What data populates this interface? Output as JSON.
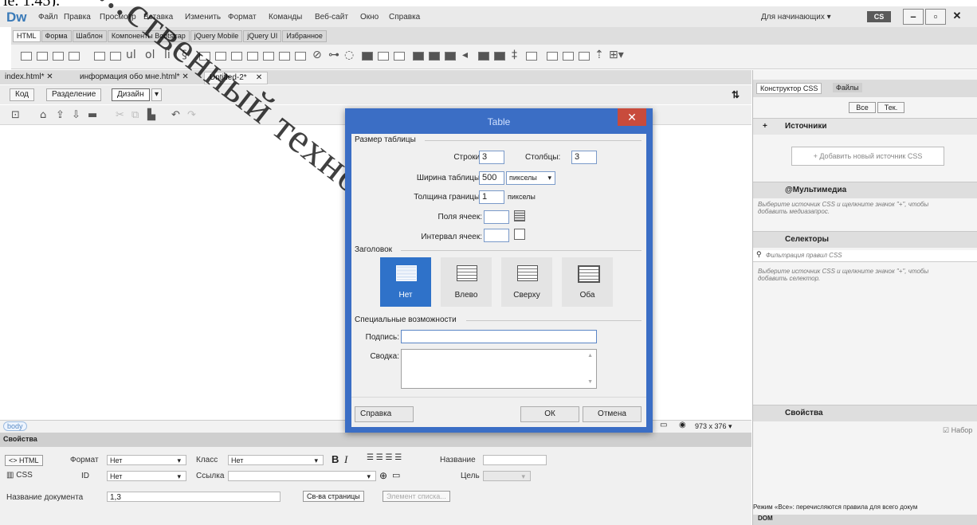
{
  "top_cut_text": "ie. 1.45).",
  "app": {
    "logo": "Dw",
    "menu": [
      "Файл",
      "Правка",
      "Просмотр",
      "Вставка",
      "Изменить",
      "Формат",
      "Команды",
      "Веб-сайт",
      "Окно",
      "Справка"
    ],
    "workspace": "Для начинающих",
    "sync_label": "CS"
  },
  "insert_tabs": [
    "HTML",
    "Форма",
    "Шаблон",
    "Компоненты Bootstrap",
    "jQuery Mobile",
    "jQuery UI",
    "Избранное"
  ],
  "doc_tabs": [
    "index.html*",
    "информация обо мне.html*",
    "Untitled-2*"
  ],
  "view_buttons": [
    "Код",
    "Разделение",
    "Дизайн"
  ],
  "status": {
    "tag": "body",
    "size": "973 x 376"
  },
  "properties": {
    "title": "Свойства",
    "html_btn": "<> HTML",
    "css_btn": "CSS",
    "format_label": "Формат",
    "format_value": "Нет",
    "class_label": "Класс",
    "class_value": "Нет",
    "id_label": "ID",
    "id_value": "Нет",
    "link_label": "Ссылка",
    "title_label": "Название",
    "target_label": "Цель",
    "doc_title_label": "Название документа",
    "doc_title_value": "1,3",
    "page_props": "Св-ва страницы",
    "list_item": "Элемент списка..."
  },
  "right_panel": {
    "tab_css": "Конструктор CSS",
    "tab_files": "Файлы",
    "all": "Все",
    "current": "Тек.",
    "sources_head": "Источники",
    "add_source": "+ Добавить новый источник CSS",
    "media_head": "@Мультимедиа",
    "media_hint": "Выберите источник CSS и щелкните значок \"+\", чтобы добавить медиазапрос.",
    "selectors_head": "Селекторы",
    "filter_placeholder": "Фильтрация правил CSS",
    "selectors_hint": "Выберите источник CSS и щелкните значок \"+\", чтобы добавить селектор.",
    "props_head": "Свойства",
    "show_set": "Набор",
    "mode_text": "Режим «Все»: перечисляются правила для всего докум",
    "dom": "DOM"
  },
  "dialog": {
    "title": "Table",
    "size_group": "Размер таблицы",
    "rows_label": "Строки:",
    "rows_value": "3",
    "cols_label": "Столбцы:",
    "cols_value": "3",
    "width_label": "Ширина таблицы:",
    "width_value": "500",
    "width_unit": "пикселы",
    "border_label": "Толщина границы:",
    "border_value": "1",
    "border_unit": "пикселы",
    "padding_label": "Поля ячеек:",
    "spacing_label": "Интервал ячеек:",
    "header_group": "Заголовок",
    "header_options": [
      "Нет",
      "Влево",
      "Сверху",
      "Оба"
    ],
    "access_group": "Специальные возможности",
    "caption_label": "Подпись:",
    "summary_label": "Сводка:",
    "help": "Справка",
    "ok": "ОК",
    "cancel": "Отмена"
  },
  "watermark": "...ственный технологический ун..."
}
